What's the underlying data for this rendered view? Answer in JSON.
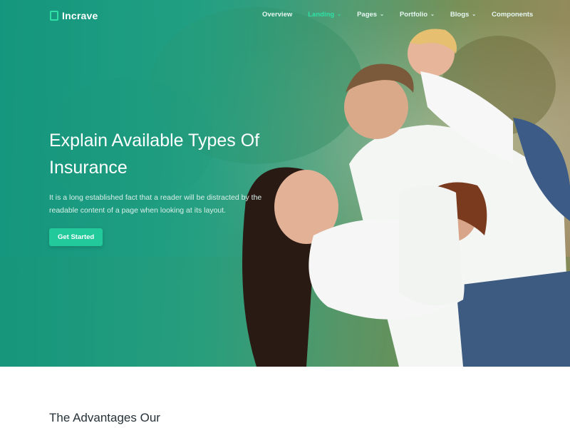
{
  "brand": {
    "name": "Incrave",
    "accent": "#2fe0a6"
  },
  "nav": {
    "items": [
      {
        "label": "Overview",
        "has_dropdown": false
      },
      {
        "label": "Landing",
        "has_dropdown": true,
        "active": true
      },
      {
        "label": "Pages",
        "has_dropdown": true
      },
      {
        "label": "Portfolio",
        "has_dropdown": true
      },
      {
        "label": "Blogs",
        "has_dropdown": true
      },
      {
        "label": "Components",
        "has_dropdown": false
      }
    ],
    "dropdown_icon": "chevron-down-icon"
  },
  "hero": {
    "title_line1": "Explain Available Types Of",
    "title_line2": "Insurance",
    "subtitle": "It is a long established fact that a reader will be distracted by the readable content of a page when looking at its layout.",
    "cta_label": "Get Started",
    "cta_color": "#21c99b"
  },
  "section": {
    "title": "The Advantages Our"
  }
}
